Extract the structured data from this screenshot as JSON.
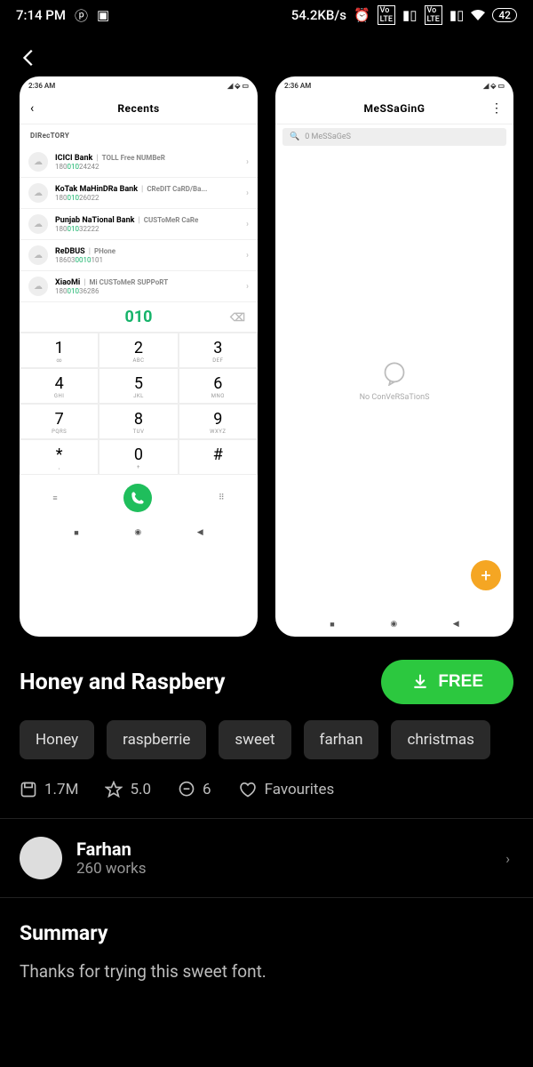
{
  "status": {
    "time": "7:14 PM",
    "speed": "54.2KB/s",
    "battery": "42"
  },
  "previews": {
    "phone": {
      "time": "2:36 AM",
      "title": "Recents",
      "section": "DIRecTORY",
      "dialed": "010",
      "rows": [
        {
          "name": "ICICI Bank",
          "tag": "TOLL Free NUMBeR",
          "num_a": "180",
          "num_b": "010",
          "num_c": "24242"
        },
        {
          "name": "KoTak MaHinDRa Bank",
          "tag": "CReDIT CaRD/Ba...",
          "num_a": "180",
          "num_b": "010",
          "num_c": "26022"
        },
        {
          "name": "Punjab NaTional Bank",
          "tag": "CUSToMeR CaRe",
          "num_a": "180",
          "num_b": "010",
          "num_c": "32222"
        },
        {
          "name": "ReDBUS",
          "tag": "PHone",
          "num_a": "18603",
          "num_b": "0010",
          "num_c": "101"
        },
        {
          "name": "XiaoMi",
          "tag": "Mi CUSToMeR SUPPoRT",
          "num_a": "180",
          "num_b": "010",
          "num_c": "36286"
        }
      ],
      "keys": [
        {
          "d": "1",
          "l": "∞"
        },
        {
          "d": "2",
          "l": "ABC"
        },
        {
          "d": "3",
          "l": "DEF"
        },
        {
          "d": "4",
          "l": "GHI"
        },
        {
          "d": "5",
          "l": "JKL"
        },
        {
          "d": "6",
          "l": "MNO"
        },
        {
          "d": "7",
          "l": "PQRS"
        },
        {
          "d": "8",
          "l": "TUV"
        },
        {
          "d": "9",
          "l": "WXYZ"
        },
        {
          "d": "*",
          "l": ","
        },
        {
          "d": "0",
          "l": "+"
        },
        {
          "d": "#",
          "l": ""
        }
      ]
    },
    "messaging": {
      "time": "2:36 AM",
      "title": "MeSSaGinG",
      "search": "0 MeSSaGeS",
      "empty": "No ConVeRSaTionS"
    }
  },
  "product": {
    "title": "Honey and Raspbery",
    "cta": "FREE",
    "tags": [
      "Honey",
      "raspberrie",
      "sweet",
      "farhan",
      "christmas"
    ],
    "stats": {
      "downloads": "1.7M",
      "rating": "5.0",
      "comments": "6",
      "fav": "Favourites"
    },
    "author": {
      "name": "Farhan",
      "works": "260 works"
    },
    "summary_h": "Summary",
    "summary_p": "Thanks for trying this sweet font."
  }
}
